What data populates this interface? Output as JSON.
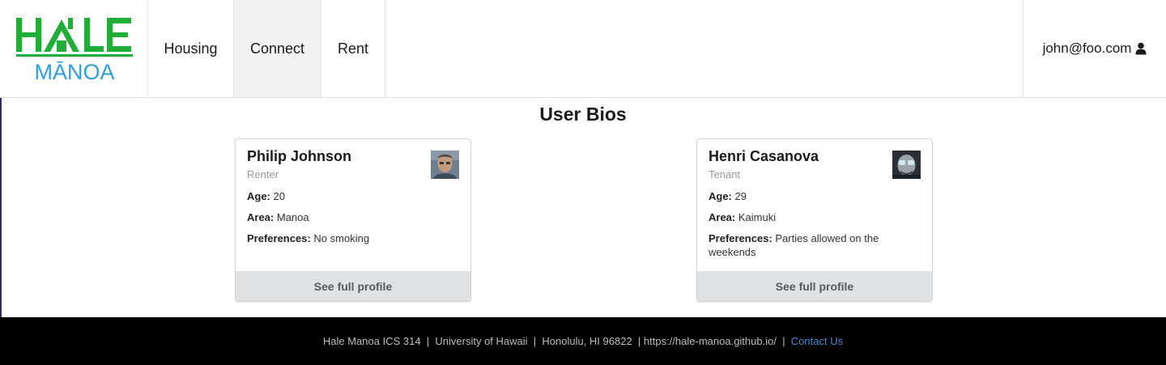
{
  "brand": {
    "line1": "HALE",
    "line2": "MĀNOA",
    "green": "#1fae3a",
    "blue": "#2f9fd8"
  },
  "nav": {
    "items": [
      {
        "label": "Housing",
        "active": false
      },
      {
        "label": "Connect",
        "active": true
      },
      {
        "label": "Rent",
        "active": false
      }
    ],
    "user_email": "john@foo.com",
    "user_icon": "user-icon"
  },
  "main": {
    "title": "User Bios",
    "cards": [
      {
        "name": "Philip Johnson",
        "role": "Renter",
        "age_label": "Age:",
        "age": "20",
        "area_label": "Area:",
        "area": "Manoa",
        "pref_label": "Preferences:",
        "preferences": "No smoking",
        "action": "See full profile"
      },
      {
        "name": "Henri Casanova",
        "role": "Tenant",
        "age_label": "Age:",
        "age": "29",
        "area_label": "Area:",
        "area": "Kaimuki",
        "pref_label": "Preferences:",
        "preferences": "Parties allowed on the weekends",
        "action": "See full profile"
      }
    ]
  },
  "footer": {
    "org": "Hale Manoa ICS 314",
    "university": "University of Hawaii",
    "location": "Honolulu, HI 96822",
    "url": "https://hale-manoa.github.io/",
    "contact": "Contact Us",
    "link_color": "#4b86d6"
  }
}
